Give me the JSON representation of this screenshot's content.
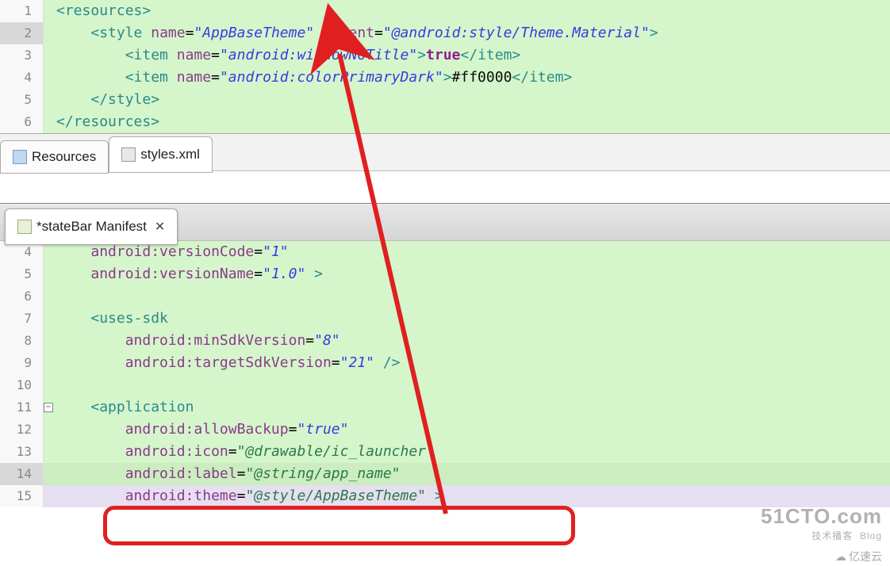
{
  "topEditor": {
    "lines": [
      {
        "n": "1",
        "segments": [
          {
            "c": "t-bracket",
            "t": "<"
          },
          {
            "c": "t-tag",
            "t": "resources"
          },
          {
            "c": "t-bracket",
            "t": ">"
          }
        ]
      },
      {
        "n": "2",
        "segments": [
          {
            "c": "",
            "t": "    "
          },
          {
            "c": "t-bracket",
            "t": "<"
          },
          {
            "c": "t-tag",
            "t": "style "
          },
          {
            "c": "t-attr",
            "t": "name"
          },
          {
            "c": "t-eq",
            "t": "="
          },
          {
            "c": "t-val",
            "t": "\"AppBaseTheme\" "
          },
          {
            "c": "t-attr",
            "t": "parent"
          },
          {
            "c": "t-eq",
            "t": "="
          },
          {
            "c": "t-val",
            "t": "\"@android:style/Theme.Material\""
          },
          {
            "c": "t-bracket",
            "t": ">"
          }
        ]
      },
      {
        "n": "3",
        "segments": [
          {
            "c": "",
            "t": "        "
          },
          {
            "c": "t-bracket",
            "t": "<"
          },
          {
            "c": "t-tag",
            "t": "item "
          },
          {
            "c": "t-attr",
            "t": "name"
          },
          {
            "c": "t-eq",
            "t": "="
          },
          {
            "c": "t-val",
            "t": "\"android:windowNoTitle\""
          },
          {
            "c": "t-bracket",
            "t": ">"
          },
          {
            "c": "t-kw",
            "t": "true"
          },
          {
            "c": "t-bracket",
            "t": "</"
          },
          {
            "c": "t-tag",
            "t": "item"
          },
          {
            "c": "t-bracket",
            "t": ">"
          }
        ]
      },
      {
        "n": "4",
        "segments": [
          {
            "c": "",
            "t": "        "
          },
          {
            "c": "t-bracket",
            "t": "<"
          },
          {
            "c": "t-tag",
            "t": "item "
          },
          {
            "c": "t-attr",
            "t": "name"
          },
          {
            "c": "t-eq",
            "t": "="
          },
          {
            "c": "t-val",
            "t": "\"android:colorPrimaryDark\""
          },
          {
            "c": "t-bracket",
            "t": ">"
          },
          {
            "c": "t-hex",
            "t": "#ff0000"
          },
          {
            "c": "t-bracket",
            "t": "</"
          },
          {
            "c": "t-tag",
            "t": "item"
          },
          {
            "c": "t-bracket",
            "t": ">"
          }
        ]
      },
      {
        "n": "5",
        "segments": [
          {
            "c": "",
            "t": "    "
          },
          {
            "c": "t-bracket",
            "t": "</"
          },
          {
            "c": "t-tag",
            "t": "style"
          },
          {
            "c": "t-bracket",
            "t": ">"
          }
        ]
      },
      {
        "n": "6",
        "segments": [
          {
            "c": "t-bracket",
            "t": "</"
          },
          {
            "c": "t-tag",
            "t": "resources"
          },
          {
            "c": "t-bracket",
            "t": ">"
          }
        ]
      }
    ],
    "tabs": [
      {
        "label": "Resources",
        "iconClass": "icon-resource"
      },
      {
        "label": "styles.xml",
        "iconClass": "icon-xml"
      }
    ]
  },
  "bottomEditor": {
    "tab": {
      "label": "*stateBar Manifest",
      "iconClass": "icon-manifest"
    },
    "lines": [
      {
        "n": "4",
        "hl": "hl-normal",
        "segments": [
          {
            "c": "",
            "t": "    "
          },
          {
            "c": "t-attr",
            "t": "android:versionCode"
          },
          {
            "c": "t-eq",
            "t": "="
          },
          {
            "c": "t-val",
            "t": "\"1\""
          }
        ]
      },
      {
        "n": "5",
        "hl": "hl-normal",
        "segments": [
          {
            "c": "",
            "t": "    "
          },
          {
            "c": "t-attr",
            "t": "android:versionName"
          },
          {
            "c": "t-eq",
            "t": "="
          },
          {
            "c": "t-val",
            "t": "\"1.0\""
          },
          {
            "c": "t-bracket",
            "t": " >"
          }
        ]
      },
      {
        "n": "6",
        "hl": "hl-normal",
        "segments": [
          {
            "c": "",
            "t": ""
          }
        ]
      },
      {
        "n": "7",
        "hl": "hl-normal",
        "segments": [
          {
            "c": "",
            "t": "    "
          },
          {
            "c": "t-bracket",
            "t": "<"
          },
          {
            "c": "t-tag",
            "t": "uses-sdk"
          }
        ]
      },
      {
        "n": "8",
        "hl": "hl-normal",
        "segments": [
          {
            "c": "",
            "t": "        "
          },
          {
            "c": "t-attr",
            "t": "android:minSdkVersion"
          },
          {
            "c": "t-eq",
            "t": "="
          },
          {
            "c": "t-val",
            "t": "\"8\""
          }
        ]
      },
      {
        "n": "9",
        "hl": "hl-normal",
        "segments": [
          {
            "c": "",
            "t": "        "
          },
          {
            "c": "t-attr",
            "t": "android:targetSdkVersion"
          },
          {
            "c": "t-eq",
            "t": "="
          },
          {
            "c": "t-val",
            "t": "\"21\""
          },
          {
            "c": "t-bracket",
            "t": " />"
          }
        ]
      },
      {
        "n": "10",
        "hl": "hl-normal",
        "segments": [
          {
            "c": "",
            "t": ""
          }
        ]
      },
      {
        "n": "11",
        "hl": "hl-normal",
        "fold": true,
        "segments": [
          {
            "c": "",
            "t": "    "
          },
          {
            "c": "t-bracket",
            "t": "<"
          },
          {
            "c": "t-tag",
            "t": "application"
          }
        ]
      },
      {
        "n": "12",
        "hl": "hl-normal",
        "segments": [
          {
            "c": "",
            "t": "        "
          },
          {
            "c": "t-attr",
            "t": "android:allowBackup"
          },
          {
            "c": "t-eq",
            "t": "="
          },
          {
            "c": "t-val",
            "t": "\"true\""
          }
        ]
      },
      {
        "n": "13",
        "hl": "hl-normal",
        "segments": [
          {
            "c": "",
            "t": "        "
          },
          {
            "c": "t-attr",
            "t": "android:icon"
          },
          {
            "c": "t-eq",
            "t": "="
          },
          {
            "c": "t-val-green",
            "t": "\"@drawable/ic_launcher\""
          }
        ]
      },
      {
        "n": "14",
        "hl": "hl-current",
        "segments": [
          {
            "c": "",
            "t": "        "
          },
          {
            "c": "t-attr",
            "t": "android:label"
          },
          {
            "c": "t-eq",
            "t": "="
          },
          {
            "c": "t-val-green",
            "t": "\"@string/app_name\""
          }
        ]
      },
      {
        "n": "15",
        "hl": "hl-lilac",
        "segments": [
          {
            "c": "",
            "t": "        "
          },
          {
            "c": "t-attr",
            "t": "android:theme"
          },
          {
            "c": "t-eq",
            "t": "="
          },
          {
            "c": "t-val-green",
            "t": "\"@style/AppBaseTheme\""
          },
          {
            "c": "t-bracket",
            "t": " >"
          }
        ]
      }
    ]
  },
  "watermark": {
    "big": "51CTO.com",
    "small1": "技术播客",
    "small2": "Blog",
    "brand2": "亿速云"
  }
}
